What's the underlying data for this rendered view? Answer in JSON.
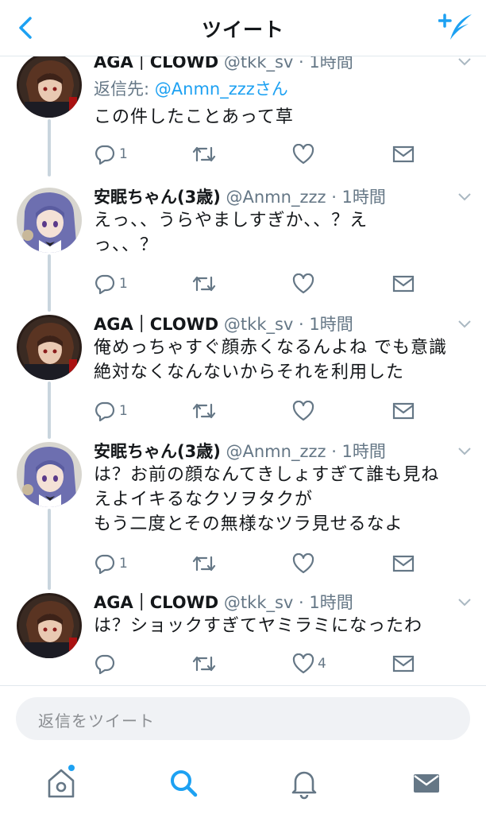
{
  "header": {
    "title": "ツイート"
  },
  "tweets": [
    {
      "name": "AGA｜CLOWD",
      "handle": "@tkk_sv",
      "time": "1時間",
      "reply_prefix": "返信先: ",
      "reply_mention": "@Anmn_zzzさん",
      "text": "この件したことあって草",
      "replies": "1",
      "likes": ""
    },
    {
      "name": "安眠ちゃん(3歳)",
      "handle": "@Anmn_zzz",
      "time": "1時間",
      "text": "えっ、、うらやましすぎか、、？え\nっ、、？",
      "replies": "1",
      "likes": ""
    },
    {
      "name": "AGA｜CLOWD",
      "handle": "@tkk_sv",
      "time": "1時間",
      "text": "俺めっちゃすぐ顔赤くなるんよね でも意識\n絶対なくなんないからそれを利用した",
      "replies": "1",
      "likes": ""
    },
    {
      "name": "安眠ちゃん(3歳)",
      "handle": "@Anmn_zzz",
      "time": "1時間",
      "text": "は？お前の顔なんてきしょすぎて誰も見ね\nえよイキるなクソヲタクが\nもう二度とその無様なツラ見せるなよ",
      "replies": "1",
      "likes": ""
    },
    {
      "name": "AGA｜CLOWD",
      "handle": "@tkk_sv",
      "time": "1時間",
      "text": "は？ショックすぎてヤミラミになったわ",
      "replies": "",
      "likes": "4"
    }
  ],
  "reply_box": {
    "placeholder": "返信をツイート"
  },
  "tabbar": {
    "items": [
      "home-icon",
      "search-icon",
      "notifications-icon",
      "messages-icon"
    ]
  },
  "colors": {
    "accent": "#1da1f2",
    "text_secondary": "#657786",
    "thread_line": "#c9d5de"
  }
}
